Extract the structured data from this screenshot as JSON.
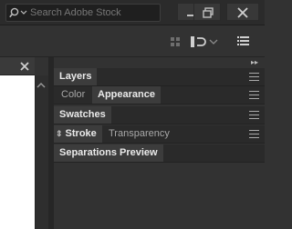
{
  "search": {
    "placeholder": "Search Adobe Stock"
  },
  "window": {
    "minimize": "minimize",
    "restore": "restore",
    "close": "close"
  },
  "toolbar": {
    "arrange_icon": "arrange-documents-icon",
    "workspace_icon": "workspace-switcher-icon",
    "panel_menu_icon": "panel-menu-icon"
  },
  "document": {
    "close_icon": "close-icon"
  },
  "panels": {
    "layers": {
      "label": "Layers"
    },
    "color_appearance": {
      "tab_color": "Color",
      "tab_appearance": "Appearance"
    },
    "swatches": {
      "label": "Swatches"
    },
    "stroke_transparency": {
      "tab_stroke": "Stroke",
      "tab_transparency": "Transparency"
    },
    "separations": {
      "label": "Separations Preview"
    }
  },
  "colors": {
    "panel_bg": "#323232",
    "tab_active": "#3c3c3c",
    "header_bg": "#2a2a2a",
    "canvas": "#ffffff"
  }
}
